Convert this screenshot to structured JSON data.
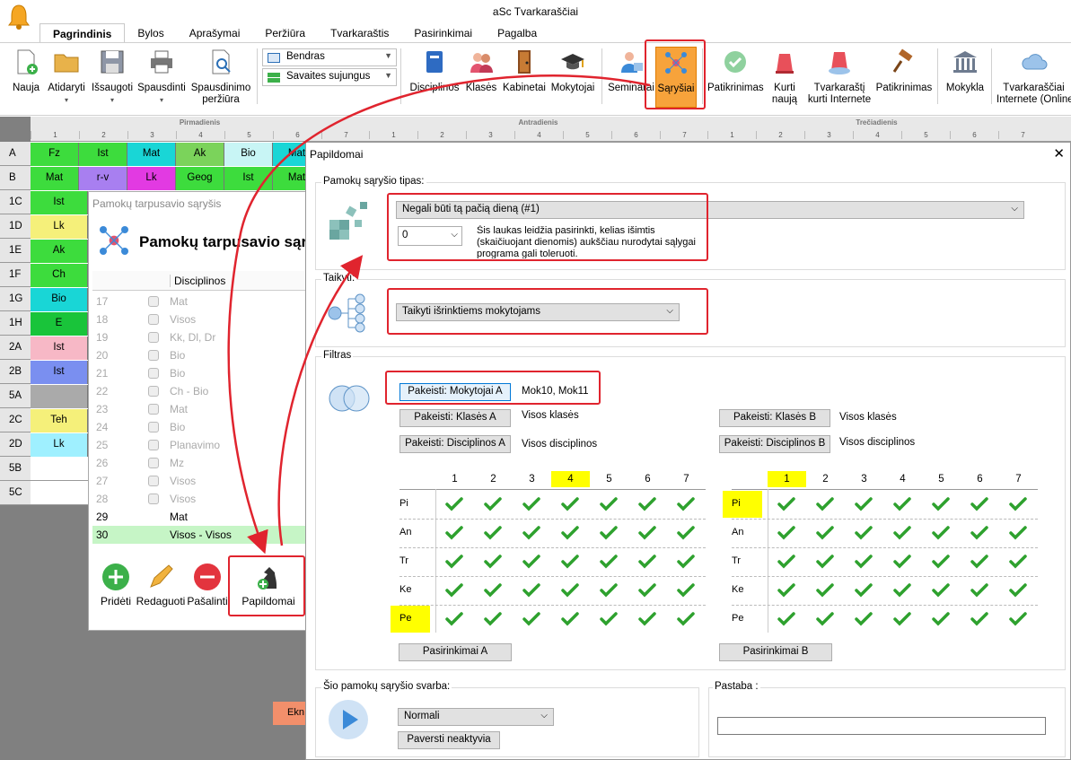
{
  "app": {
    "title": "aSc Tvarkaraščiai"
  },
  "tabs": [
    "Pagrindinis",
    "Bylos",
    "Aprašymai",
    "Peržiūra",
    "Tvarkaraštis",
    "Pasirinkimai",
    "Pagalba"
  ],
  "ribbon": {
    "nauja": "Nauja",
    "atidaryti": "Atidaryti",
    "issaugoti": "Išsaugoti",
    "spausdinti": "Spausdinti",
    "spausd_perz1": "Spausdinimo",
    "spausd_perz2": "peržiūra",
    "combo1": "Bendras",
    "combo2": "Savaites sujungus",
    "disciplinos": "Disciplinos",
    "klases": "Klasės",
    "kabinetai": "Kabinetai",
    "mokytojai": "Mokytojai",
    "seminarai": "Seminarai",
    "sarysiai": "Sąryšiai",
    "patikrinimas": "Patikrinimas",
    "kurti1": "Kurti",
    "kurti2": "naują",
    "tvark1": "Tvarkaraštį",
    "tvark2": "kurti Internete",
    "patikrinimas2": "Patikrinimas",
    "mokykla": "Mokykla",
    "internet1": "Tvarkaraščiai",
    "internet2": "Internete (Online)"
  },
  "grid": {
    "days": [
      "Pirmadienis",
      "Antradienis",
      "Trečiadienis"
    ],
    "periods": [
      "1",
      "2",
      "3",
      "4",
      "5",
      "6",
      "7"
    ],
    "rows": [
      "A",
      "B",
      "1C",
      "1D",
      "1E",
      "1F",
      "1G",
      "1H",
      "2A",
      "2B",
      "5A",
      "2C",
      "2D",
      "5B",
      "5C"
    ],
    "row_cells": [
      [
        "Fz",
        "Ist",
        "Mat",
        "Ak",
        "Bio",
        "Mat"
      ],
      [
        "Mat",
        "r-v",
        "Lk",
        "Geog",
        "Ist",
        "Mat"
      ]
    ],
    "left_cells": [
      "Ist",
      "Lk",
      "Ak",
      "Ch",
      "Bio",
      "E",
      "Ist",
      "Ist",
      "",
      "Teh",
      "Lk"
    ],
    "ekn": "Ekn"
  },
  "small_dialog": {
    "title": "Pamokų tarpusavio sąryšis",
    "heading": "Pamokų tarpusavio sąrys",
    "col_header": "Disciplinos",
    "rows": [
      [
        "17",
        "Mat"
      ],
      [
        "18",
        "Visos"
      ],
      [
        "19",
        "Kk, Dl, Dr"
      ],
      [
        "20",
        "Bio"
      ],
      [
        "21",
        "Bio"
      ],
      [
        "22",
        "Ch - Bio"
      ],
      [
        "23",
        "Mat"
      ],
      [
        "24",
        "Bio"
      ],
      [
        "25",
        "Planavimo"
      ],
      [
        "26",
        "Mz"
      ],
      [
        "27",
        "Visos"
      ],
      [
        "28",
        "Visos"
      ]
    ],
    "active_rows": [
      [
        "29",
        "Mat"
      ],
      [
        "30",
        "Visos - Visos"
      ]
    ],
    "btn_add": "Pridėti",
    "btn_edit": "Redaguoti",
    "btn_remove": "Pašalinti",
    "btn_more": "Papildomai"
  },
  "main_dialog": {
    "title": "Papildomai",
    "close": "✕",
    "type_group": "Pamokų sąryšio tipas:",
    "type_value": "Negali būti tą pačią dieną (#1)",
    "num_value": "0",
    "num_help": "Šis laukas leidžia pasirinkti, kelias išimtis (skaičiuojant dienomis) aukščiau nurodytai sąlygai programa gali toleruoti.",
    "apply_group": "Taikyti:",
    "apply_value": "Taikyti išrinktiems mokytojams",
    "filter_group": "Filtras",
    "btn_teach_a": "Pakeisti: Mokytojai A",
    "teach_a_val": "Mok10, Mok11",
    "btn_class_a": "Pakeisti: Klasės A",
    "class_a_val": "Visos klasės",
    "btn_disc_a": "Pakeisti: Disciplinos A",
    "disc_a_val": "Visos disciplinos",
    "btn_class_b": "Pakeisti: Klasės B",
    "class_b_val": "Visos klasės",
    "btn_disc_b": "Pakeisti: Disciplinos B",
    "disc_b_val": "Visos disciplinos",
    "periods": [
      "1",
      "2",
      "3",
      "4",
      "5",
      "6",
      "7"
    ],
    "days": [
      "Pi",
      "An",
      "Tr",
      "Ke",
      "Pe"
    ],
    "btn_pas_a": "Pasirinkimai A",
    "btn_pas_b": "Pasirinkimai B",
    "weight_group": "Šio pamokų sąryšio svarba:",
    "weight_value": "Normali",
    "btn_inactive": "Paversti neaktyvia",
    "note_group": "Pastaba :",
    "note_value": ""
  },
  "colors": {
    "accent": "#e0242e",
    "highlight": "#ffff00",
    "check": "#2ea12e"
  }
}
